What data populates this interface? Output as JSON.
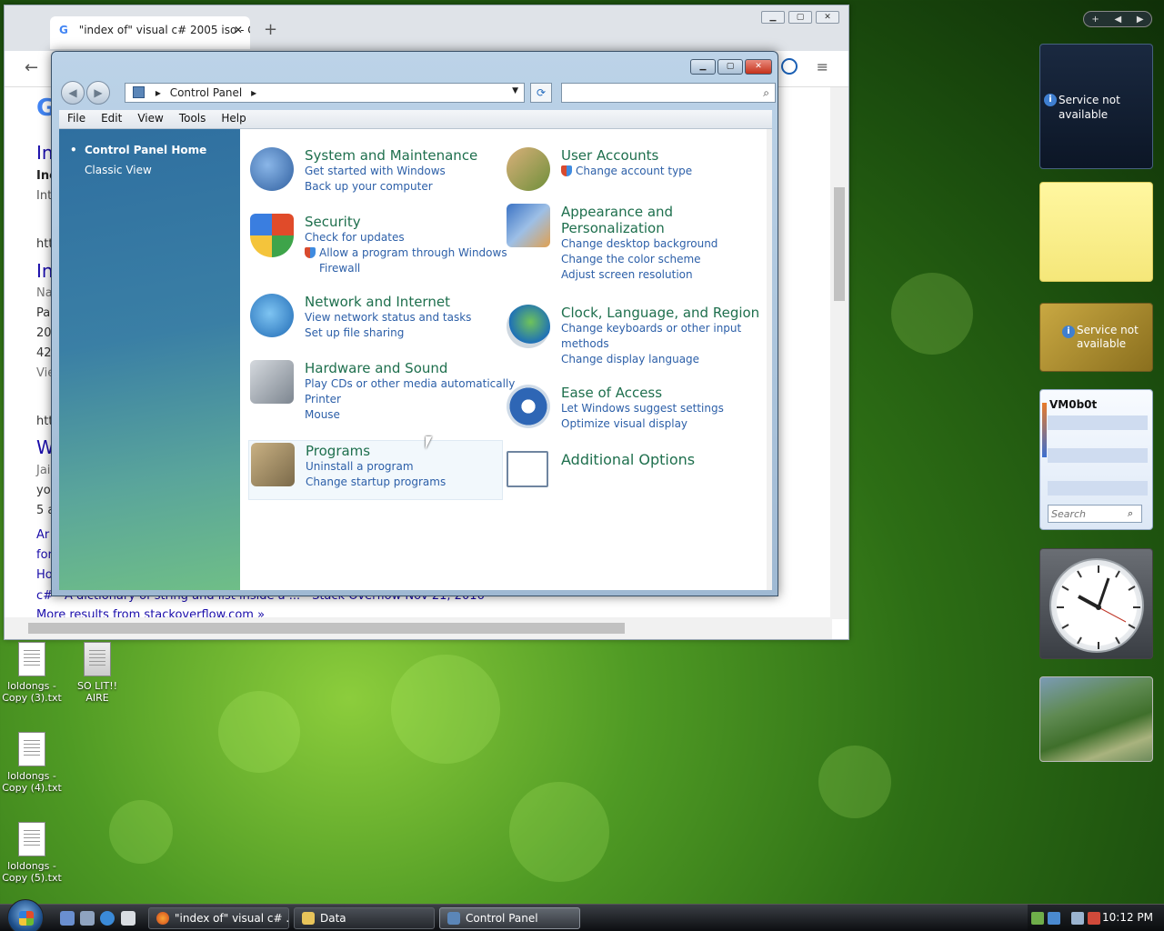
{
  "browser": {
    "tab_title": "\"index of\" visual c# 2005 iso - G...",
    "tab_close": "✕",
    "new_tab": "+",
    "win_buttons": [
      "▁",
      "▢",
      "✕"
    ],
    "back": "←",
    "menu": "≡",
    "google_letter": "G",
    "snippets": [
      "In",
      "Inc",
      "Int",
      "htt",
      "In",
      "Na",
      "Pa",
      "20",
      "42",
      "Vie",
      "htt",
      "W",
      "Jai",
      "yo",
      "5 a",
      "Ar",
      "for",
      "Ho"
    ],
    "bottom_link": "c# - A dictionary of string and list inside a ... - Stack Overflow      Nov 21, 2016",
    "more_results": "More results from stackoverflow.com »"
  },
  "control_panel": {
    "caption_buttons": [
      "▁",
      "▢",
      "✕"
    ],
    "nav_back": "◀",
    "nav_forward": "▶",
    "address": "Control Panel",
    "address_sep": "▸",
    "address_dropdown": "▼",
    "refresh": "⟳",
    "search_placeholder": "",
    "search_icon": "⌕",
    "menu": [
      "File",
      "Edit",
      "View",
      "Tools",
      "Help"
    ],
    "sidebar": {
      "home": "Control Panel Home",
      "classic": "Classic View"
    },
    "categories": [
      {
        "icon": "system-maintenance-icon",
        "title": "System and Maintenance",
        "links": [
          "Get started with Windows",
          "Back up your computer"
        ]
      },
      {
        "icon": "user-accounts-icon",
        "title": "User Accounts",
        "links": [
          "Change account type"
        ]
      },
      {
        "icon": "security-shield-icon",
        "title": "Security",
        "links": [
          "Check for updates",
          "Allow a program through Windows",
          "Firewall"
        ]
      },
      {
        "icon": "appearance-icon",
        "title": "Appearance and",
        "title2": "Personalization",
        "links": [
          "Change desktop background",
          "Change the color scheme",
          "Adjust screen resolution"
        ]
      },
      {
        "icon": "network-globe-icon",
        "title": "Network and Internet",
        "links": [
          "View network status and tasks",
          "Set up file sharing"
        ]
      },
      {
        "icon": "clock-globe-icon",
        "title": "Clock, Language, and Region",
        "links": [
          "Change keyboards or other input",
          "methods",
          "Change display language"
        ]
      },
      {
        "icon": "hardware-printer-icon",
        "title": "Hardware and Sound",
        "links": [
          "Play CDs or other media automatically",
          "Printer",
          "Mouse"
        ]
      },
      {
        "icon": "ease-of-access-icon",
        "title": "Ease of Access",
        "links": [
          "Let Windows suggest settings",
          "Optimize visual display"
        ]
      },
      {
        "icon": "programs-icon",
        "title": "Programs",
        "links": [
          "Uninstall a program",
          "Change startup programs"
        ]
      },
      {
        "icon": "additional-options-icon",
        "title": "Additional Options",
        "links": []
      }
    ]
  },
  "gadgets": {
    "bar": [
      "+",
      "◀",
      "▶"
    ],
    "service1": "Service not available",
    "service2": "Service not available",
    "info": "i",
    "feed_title": "VM0b0t",
    "feed_search_placeholder": "Search",
    "feed_search_icon": "⌕"
  },
  "desktop_icons": [
    {
      "label": "loldongs - Copy (3).txt"
    },
    {
      "label": "SO LIT!! AIRE"
    },
    {
      "label": "loldongs - Copy (4).txt"
    },
    {
      "label": "loldongs - Copy (5).txt"
    }
  ],
  "taskbar": {
    "tasks": [
      "\"index of\" visual c# ...",
      "Data",
      "Control Panel"
    ],
    "clock": "10:12 PM"
  }
}
